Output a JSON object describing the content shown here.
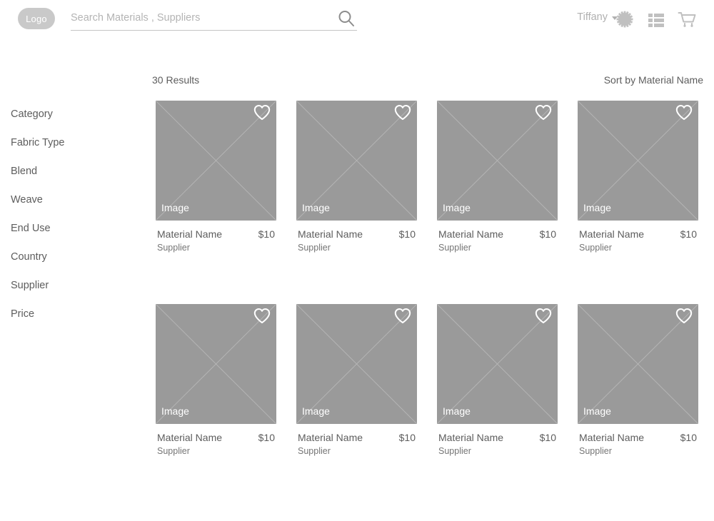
{
  "header": {
    "logo_label": "Logo",
    "search": {
      "value": "",
      "placeholder": "Search Materials , Suppliers",
      "icon": "search-icon"
    },
    "user_name": "Tiffany",
    "icons": [
      {
        "name": "gear-icon"
      },
      {
        "name": "list-icon"
      },
      {
        "name": "cart-icon"
      }
    ]
  },
  "sidebar": {
    "items": [
      {
        "label": "Category"
      },
      {
        "label": "Fabric Type"
      },
      {
        "label": "Blend"
      },
      {
        "label": "Weave"
      },
      {
        "label": "End Use"
      },
      {
        "label": "Country"
      },
      {
        "label": "Supplier"
      },
      {
        "label": "Price"
      }
    ]
  },
  "results": {
    "count_label": "30 Results",
    "sort_label": "Sort by Material Name"
  },
  "products": [
    {
      "image_label": "Image",
      "name": "Material Name",
      "supplier": "Supplier",
      "price": "$10",
      "favorite_icon": "heart-icon"
    },
    {
      "image_label": "Image",
      "name": "Material Name",
      "supplier": "Supplier",
      "price": "$10",
      "favorite_icon": "heart-icon"
    },
    {
      "image_label": "Image",
      "name": "Material Name",
      "supplier": "Supplier",
      "price": "$10",
      "favorite_icon": "heart-icon"
    },
    {
      "image_label": "Image",
      "name": "Material Name",
      "supplier": "Supplier",
      "price": "$10",
      "favorite_icon": "heart-icon"
    },
    {
      "image_label": "Image",
      "name": "Material Name",
      "supplier": "Supplier",
      "price": "$10",
      "favorite_icon": "heart-icon"
    },
    {
      "image_label": "Image",
      "name": "Material Name",
      "supplier": "Supplier",
      "price": "$10",
      "favorite_icon": "heart-icon"
    },
    {
      "image_label": "Image",
      "name": "Material Name",
      "supplier": "Supplier",
      "price": "$10",
      "favorite_icon": "heart-icon"
    },
    {
      "image_label": "Image",
      "name": "Material Name",
      "supplier": "Supplier",
      "price": "$10",
      "favorite_icon": "heart-icon"
    }
  ],
  "colors": {
    "placeholder_gray": "#9a9a9a",
    "logo_gray": "#c9c9c9",
    "text_gray": "#5d5d5d",
    "muted_gray": "#b0b0b0",
    "icon_gray": "#c4c4c4"
  }
}
